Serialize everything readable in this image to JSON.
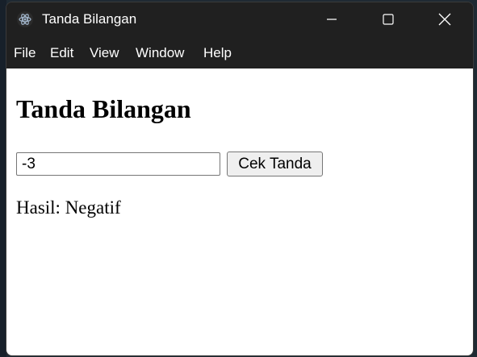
{
  "window": {
    "title": "Tanda Bilangan",
    "controls": {
      "minimize": "minimize-icon",
      "maximize": "maximize-icon",
      "close": "close-icon"
    }
  },
  "menu": {
    "items": [
      "File",
      "Edit",
      "View",
      "Window",
      "Help"
    ]
  },
  "page": {
    "heading": "Tanda Bilangan",
    "input_value": "-3",
    "button_label": "Cek Tanda",
    "result_text": "Hasil: Negatif"
  },
  "colors": {
    "titlebar_bg": "#202020",
    "content_bg": "#ffffff",
    "button_bg": "#efefef"
  }
}
